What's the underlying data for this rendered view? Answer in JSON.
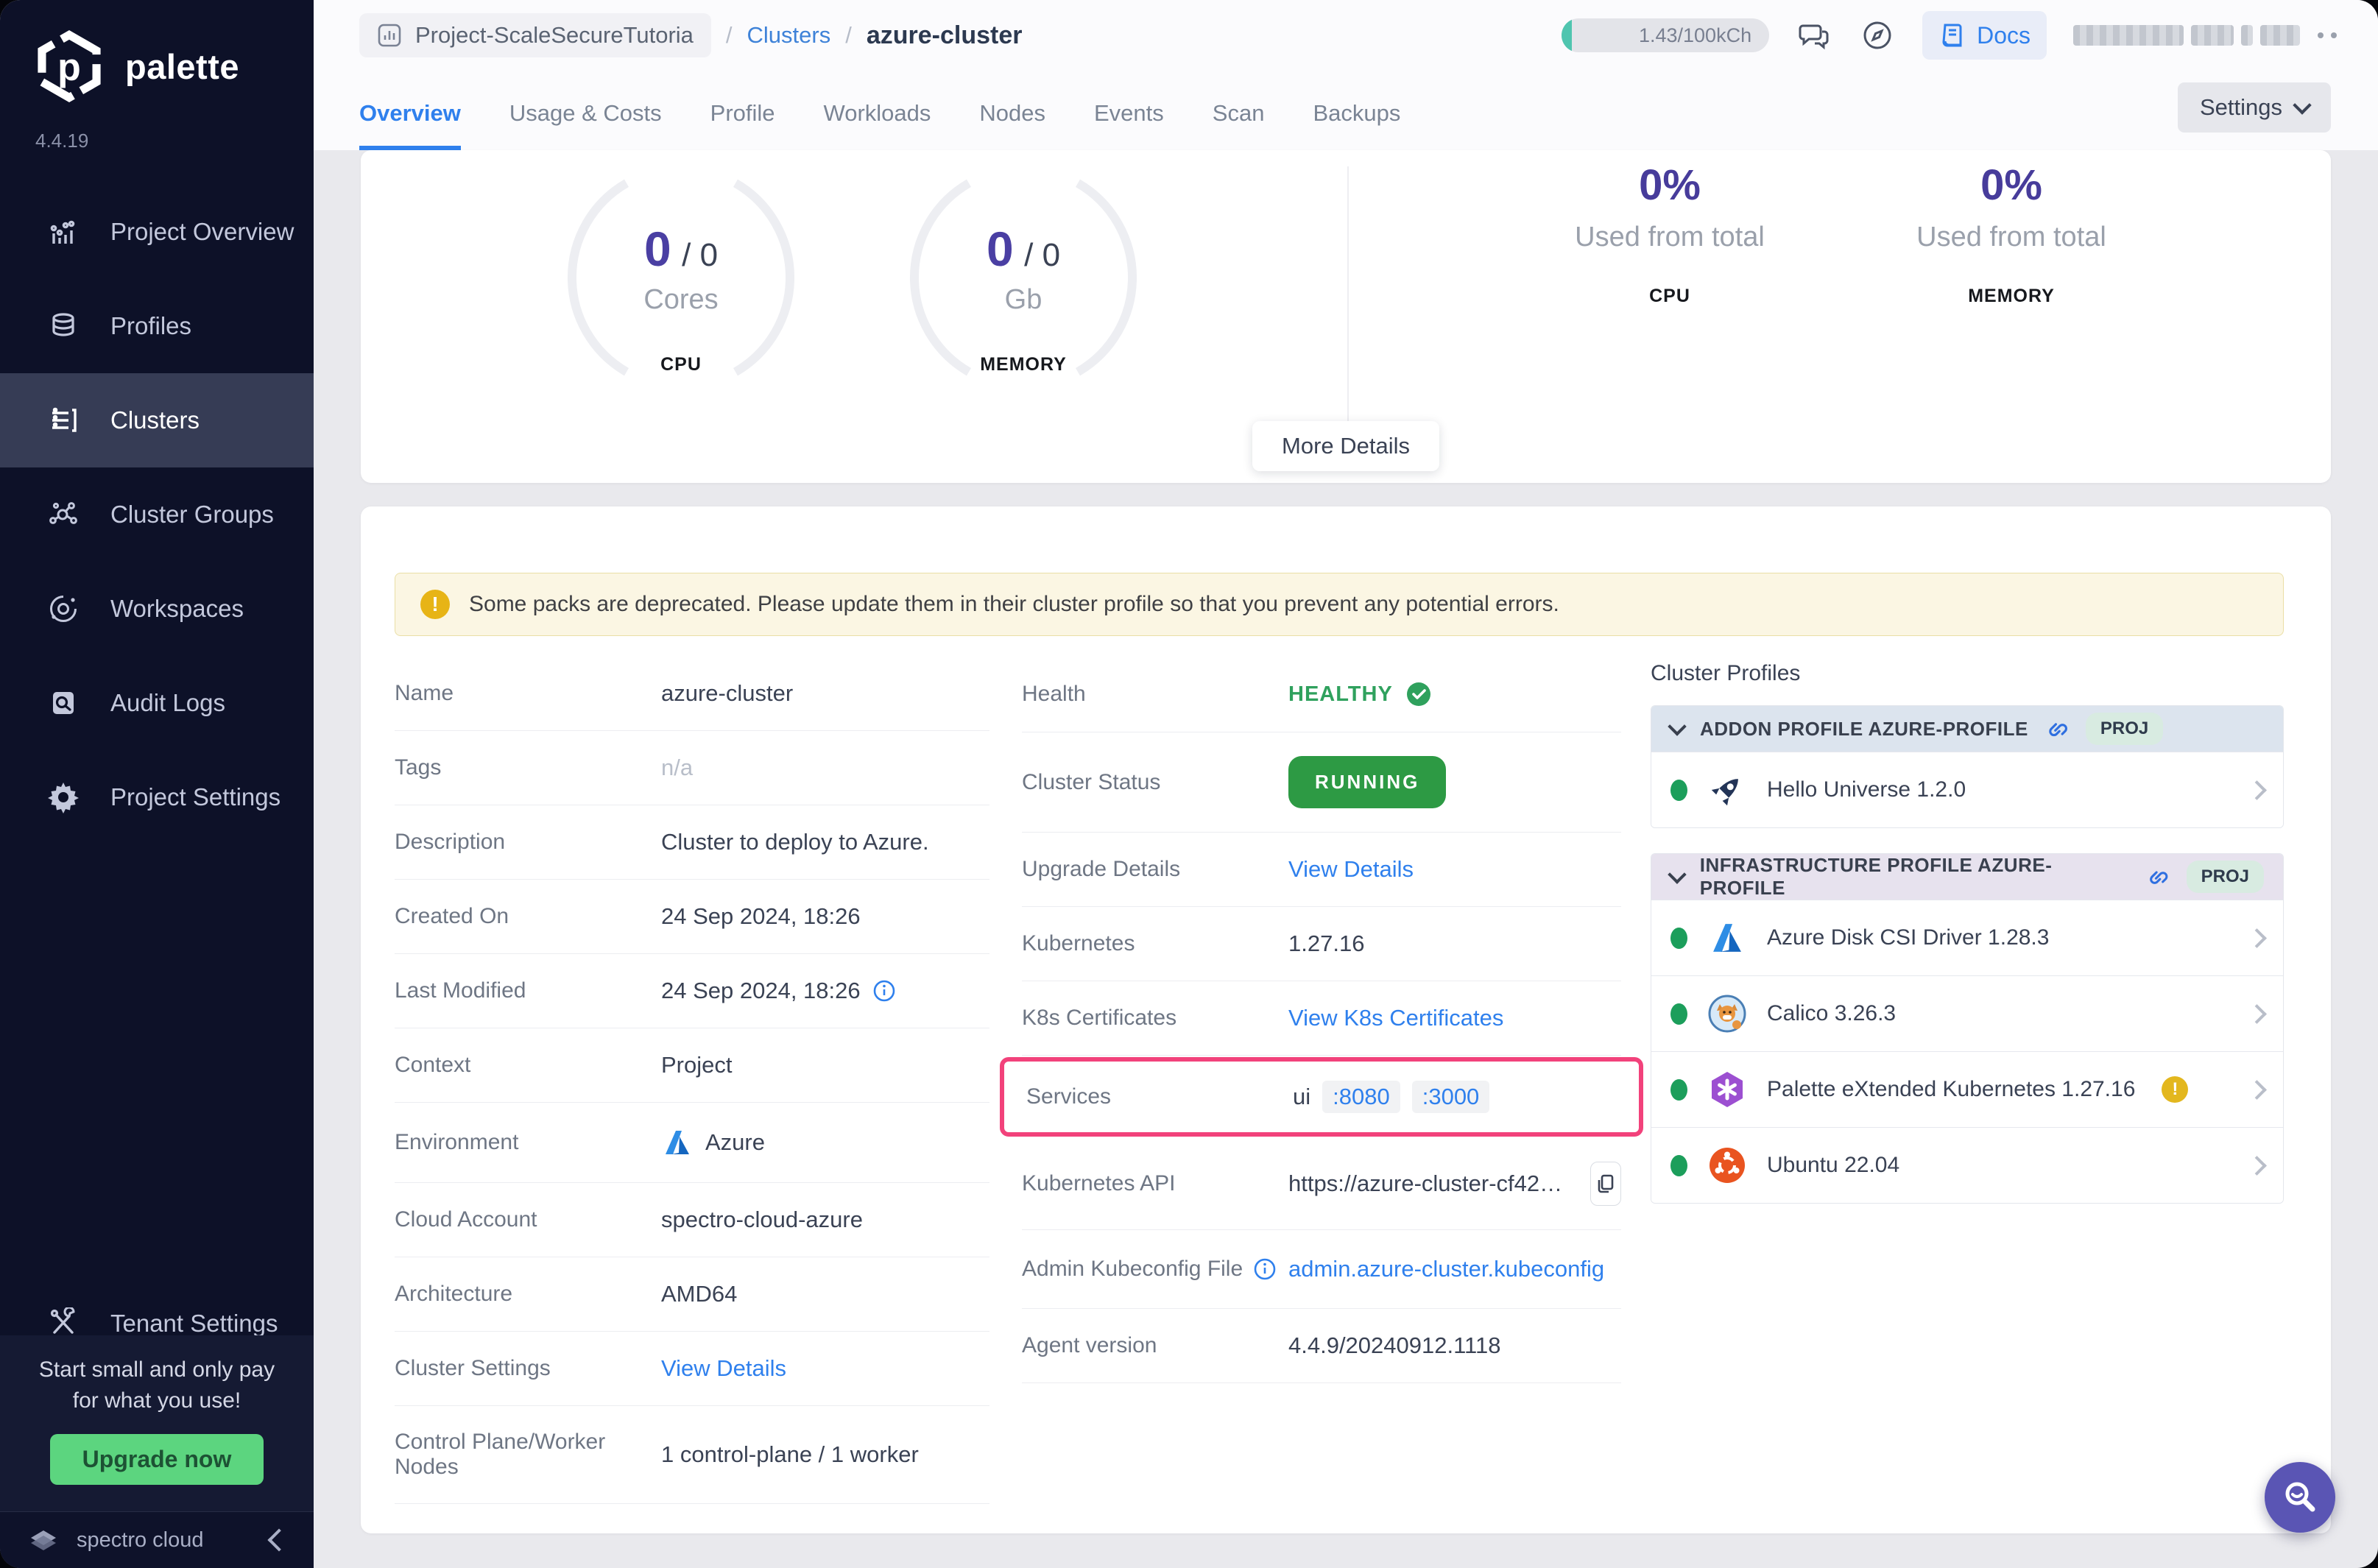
{
  "colors": {
    "accent_blue": "#2F80ED",
    "status_green": "#2D9A44",
    "metric_purple": "#4A3FA3",
    "highlight_pink": "#F2427B",
    "warning_yellow": "#E7B416",
    "sidebar_navy": "#0D1128"
  },
  "sidebar": {
    "logo_text": "palette",
    "version": "4.4.19",
    "items": [
      {
        "label": "Project Overview"
      },
      {
        "label": "Profiles"
      },
      {
        "label": "Clusters"
      },
      {
        "label": "Cluster Groups"
      },
      {
        "label": "Workspaces"
      },
      {
        "label": "Audit Logs"
      },
      {
        "label": "Project Settings"
      }
    ],
    "tenant_settings_label": "Tenant Settings",
    "upgrade": {
      "line1": "Start small and only pay",
      "line2": "for what you use!",
      "button_label": "Upgrade now"
    },
    "brand": "spectro cloud"
  },
  "header": {
    "project_chip": "Project-ScaleSecureTutoria",
    "breadcrumb_link": "Clusters",
    "breadcrumb_current": "azure-cluster",
    "usage_pill": "1.43/100kCh",
    "docs_label": "Docs",
    "settings_button": "Settings",
    "tabs": [
      {
        "label": "Overview"
      },
      {
        "label": "Usage & Costs"
      },
      {
        "label": "Profile"
      },
      {
        "label": "Workloads"
      },
      {
        "label": "Nodes"
      },
      {
        "label": "Events"
      },
      {
        "label": "Scan"
      },
      {
        "label": "Backups"
      }
    ]
  },
  "overview_card": {
    "gauges": [
      {
        "value": "0",
        "total_display": "/ 0",
        "unit": "Cores",
        "metric": "CPU"
      },
      {
        "value": "0",
        "total_display": "/ 0",
        "unit": "Gb",
        "metric": "MEMORY"
      }
    ],
    "usage_stats": [
      {
        "percent": "0%",
        "caption": "Used from total",
        "metric": "CPU"
      },
      {
        "percent": "0%",
        "caption": "Used from total",
        "metric": "MEMORY"
      }
    ],
    "more_details_label": "More Details"
  },
  "details_card": {
    "warning_mark": "!",
    "warning_text": "Some packs are deprecated. Please update them in their cluster profile so that you prevent any potential errors.",
    "left_rows": [
      {
        "label": "Name",
        "value": "azure-cluster"
      },
      {
        "label": "Tags",
        "value": "n/a"
      },
      {
        "label": "Description",
        "value": "Cluster to deploy to Azure."
      },
      {
        "label": "Created On",
        "value": "24 Sep 2024, 18:26"
      },
      {
        "label": "Last Modified",
        "value": "24 Sep 2024, 18:26"
      },
      {
        "label": "Context",
        "value": "Project"
      },
      {
        "label": "Environment",
        "value": "Azure"
      },
      {
        "label": "Cloud Account",
        "value": "spectro-cloud-azure"
      },
      {
        "label": "Architecture",
        "value": "AMD64"
      },
      {
        "label": "Cluster Settings",
        "value": "View Details"
      },
      {
        "label": "Control Plane/Worker Nodes",
        "value": "1 control-plane / 1 worker"
      }
    ],
    "middle_rows": [
      {
        "label": "Health",
        "value": "HEALTHY"
      },
      {
        "label": "Cluster Status",
        "value": "RUNNING"
      },
      {
        "label": "Upgrade Details",
        "value": "View Details"
      },
      {
        "label": "Kubernetes",
        "value": "1.27.16"
      },
      {
        "label": "K8s Certificates",
        "value": "View K8s Certificates"
      },
      {
        "label": "Services",
        "value_name": "ui",
        "ports": [
          ":8080",
          ":3000"
        ]
      },
      {
        "label": "Kubernetes API",
        "value": "https://azure-cluster-cf42…"
      },
      {
        "label": "Admin Kubeconfig File",
        "value": "admin.azure-cluster.kubeconfig"
      },
      {
        "label": "Agent version",
        "value": "4.4.9/20240912.1118"
      }
    ],
    "cluster_profiles": {
      "title": "Cluster Profiles",
      "groups": [
        {
          "name": "ADDON PROFILE AZURE-PROFILE",
          "badge": "PROJ",
          "items": [
            {
              "name": "Hello Universe 1.2.0"
            }
          ]
        },
        {
          "name": "INFRASTRUCTURE PROFILE AZURE-PROFILE",
          "badge": "PROJ",
          "items": [
            {
              "name": "Azure Disk CSI Driver 1.28.3"
            },
            {
              "name": "Calico 3.26.3"
            },
            {
              "name": "Palette eXtended Kubernetes 1.27.16"
            },
            {
              "name": "Ubuntu 22.04"
            }
          ]
        }
      ]
    }
  }
}
